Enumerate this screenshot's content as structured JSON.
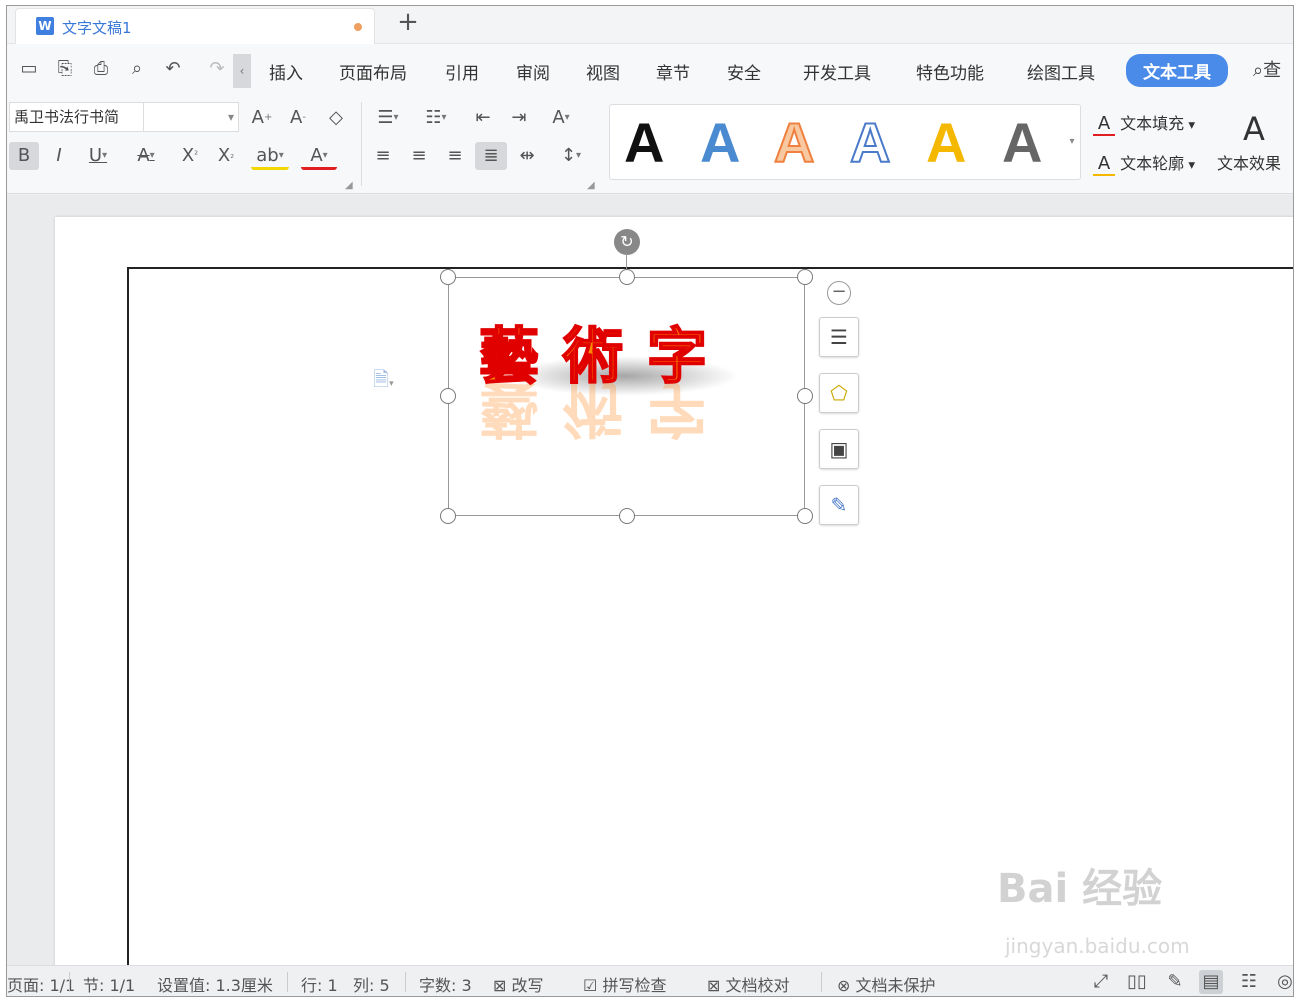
{
  "tab": {
    "title": "文字文稿1",
    "icon": "W"
  },
  "menu": {
    "items": [
      "插入",
      "页面布局",
      "引用",
      "审阅",
      "视图",
      "章节",
      "安全",
      "开发工具",
      "特色功能",
      "绘图工具",
      "文本工具"
    ],
    "active": "文本工具",
    "search_label": "查"
  },
  "toolbar": {
    "font_name": "禹卫书法行书简",
    "font_size": "",
    "style_letter": "A",
    "text_fill": "文本填充",
    "text_outline": "文本轮廓",
    "text_effect": "文本效果"
  },
  "art": {
    "text": "藝術字",
    "fill_color": "#ff8a00",
    "outline_color": "#e00000"
  },
  "status": {
    "page": "页面: 1/1",
    "section": "节: 1/1",
    "setting": "设置值: 1.3厘米",
    "row": "行: 1",
    "col": "列: 5",
    "words": "字数: 3",
    "overwrite": "改写",
    "spell": "拼写检查",
    "proof": "文档校对",
    "protect": "文档未保护"
  },
  "watermark": {
    "main": "Bai 经验",
    "sub": "jingyan.baidu.com"
  },
  "colors": {
    "accent": "#4a8ae8",
    "style_blue": "#4a8ad0",
    "style_orange": "#f08040",
    "style_yellow": "#f5b800"
  }
}
